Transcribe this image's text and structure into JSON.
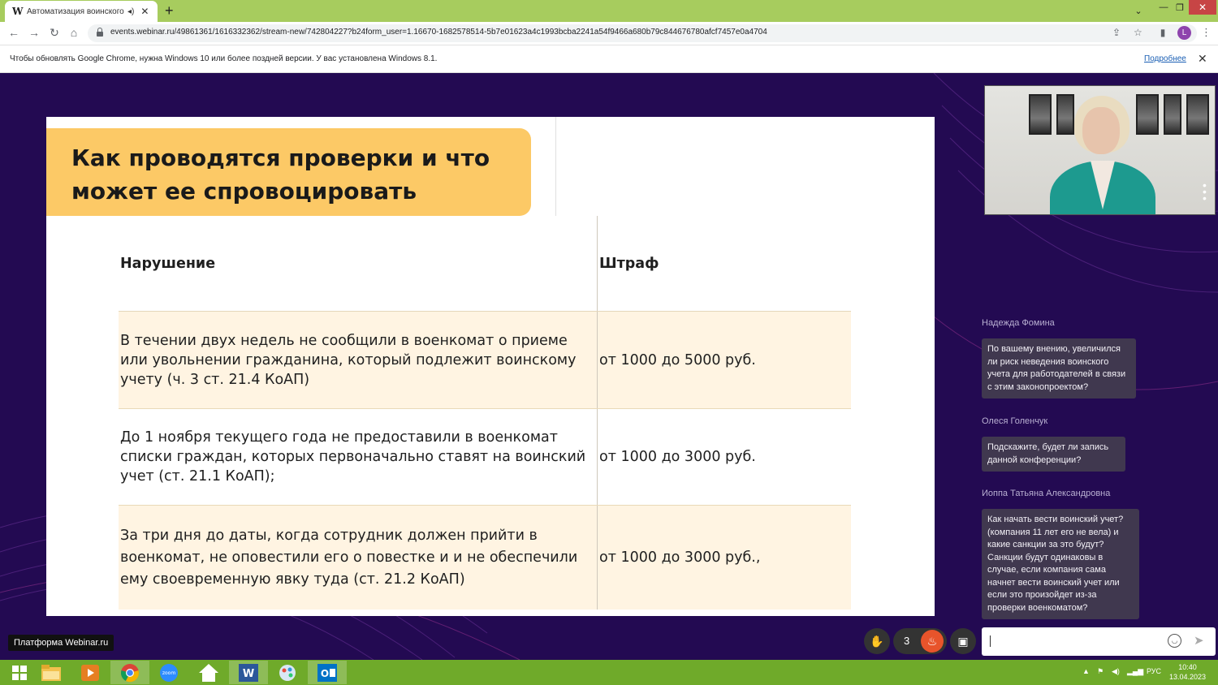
{
  "browser": {
    "tab_title": "Автоматизация воинского у",
    "url": "events.webinar.ru/49861361/1616332362/stream-new/742804227?b24form_user=1.16670-1682578514-5b7e01623a4c1993bcba2241a54f9466a680b79c844676780afcf7457e0a4704",
    "profile_initial": "L"
  },
  "infobar": {
    "message": "Чтобы обновлять Google Chrome, нужна Windows 10 или более поздней версии. У вас установлена Windows 8.1.",
    "link": "Подробнее"
  },
  "slide": {
    "title_line1": "Как проводятся проверки и что",
    "title_line2": "может ее спровоцировать",
    "table": {
      "headers": [
        "Нарушение",
        "Штраф"
      ],
      "rows": [
        {
          "violation": "В течении двух недель не сообщили в военкомат о приеме или увольнении гражданина, который подлежит воинскому учету (ч. 3 ст. 21.4 КоАП)",
          "fine": "от 1000 до 5000 руб."
        },
        {
          "violation": "До 1 ноября текущего года не предоставили в военкомат списки граждан, которых первоначально ставят на воинский учет (ст. 21.1 КоАП);",
          "fine": "от 1000 до 3000 руб."
        },
        {
          "violation": "За три дня до даты, когда сотрудник должен прийти в военкомат, не оповестили его о повестке и и не обеспечили ему своевременную явку туда (ст. 21.2 КоАП)",
          "fine": "от 1000 до 3000 руб.,"
        }
      ]
    }
  },
  "chat": {
    "messages": [
      {
        "author": "Надежда Фомина",
        "text": "По вашему внению, увеличился ли риск неведения воинского учета для работодателей в связи с этим законопроектом?"
      },
      {
        "author": "Олеся Голенчук",
        "text": "Подскажите, будет ли запись данной конференции?"
      },
      {
        "author": "Иоппа Татьяна Александровна",
        "text": "Как начать вести воинский учет? (компания 11 лет его не вела) и какие санкции за это будут? Санкции будут одинаковы в случае, если компания сама начнет вести воинский учет или если это произойдет из-за проверки военкоматом?"
      }
    ]
  },
  "controls": {
    "platform_badge": "Платформа Webinar.ru",
    "reaction_count": "3"
  },
  "taskbar": {
    "lang": "РУС",
    "time": "10:40",
    "date": "13.04.2023",
    "zoom_label": "zoom",
    "word_label": "W",
    "outlook_label": "O"
  },
  "colors": {
    "tab_strip": "#a7cc5e",
    "stage_bg": "#230a52",
    "slide_header": "#fcc966",
    "row_shade": "#fff4e2",
    "chat_bubble": "#40384f",
    "taskbar": "#6faa2a"
  },
  "icons": {
    "back": "arrow-left-icon",
    "forward": "arrow-right-icon",
    "reload": "reload-icon",
    "home": "home-icon",
    "share": "share-icon",
    "bookmark": "star-icon",
    "sidebar": "sidebar-icon",
    "hand": "raise-hand-icon",
    "fire": "fire-icon",
    "pip": "picture-in-picture-icon",
    "emoji": "emoji-icon",
    "send": "send-icon"
  }
}
